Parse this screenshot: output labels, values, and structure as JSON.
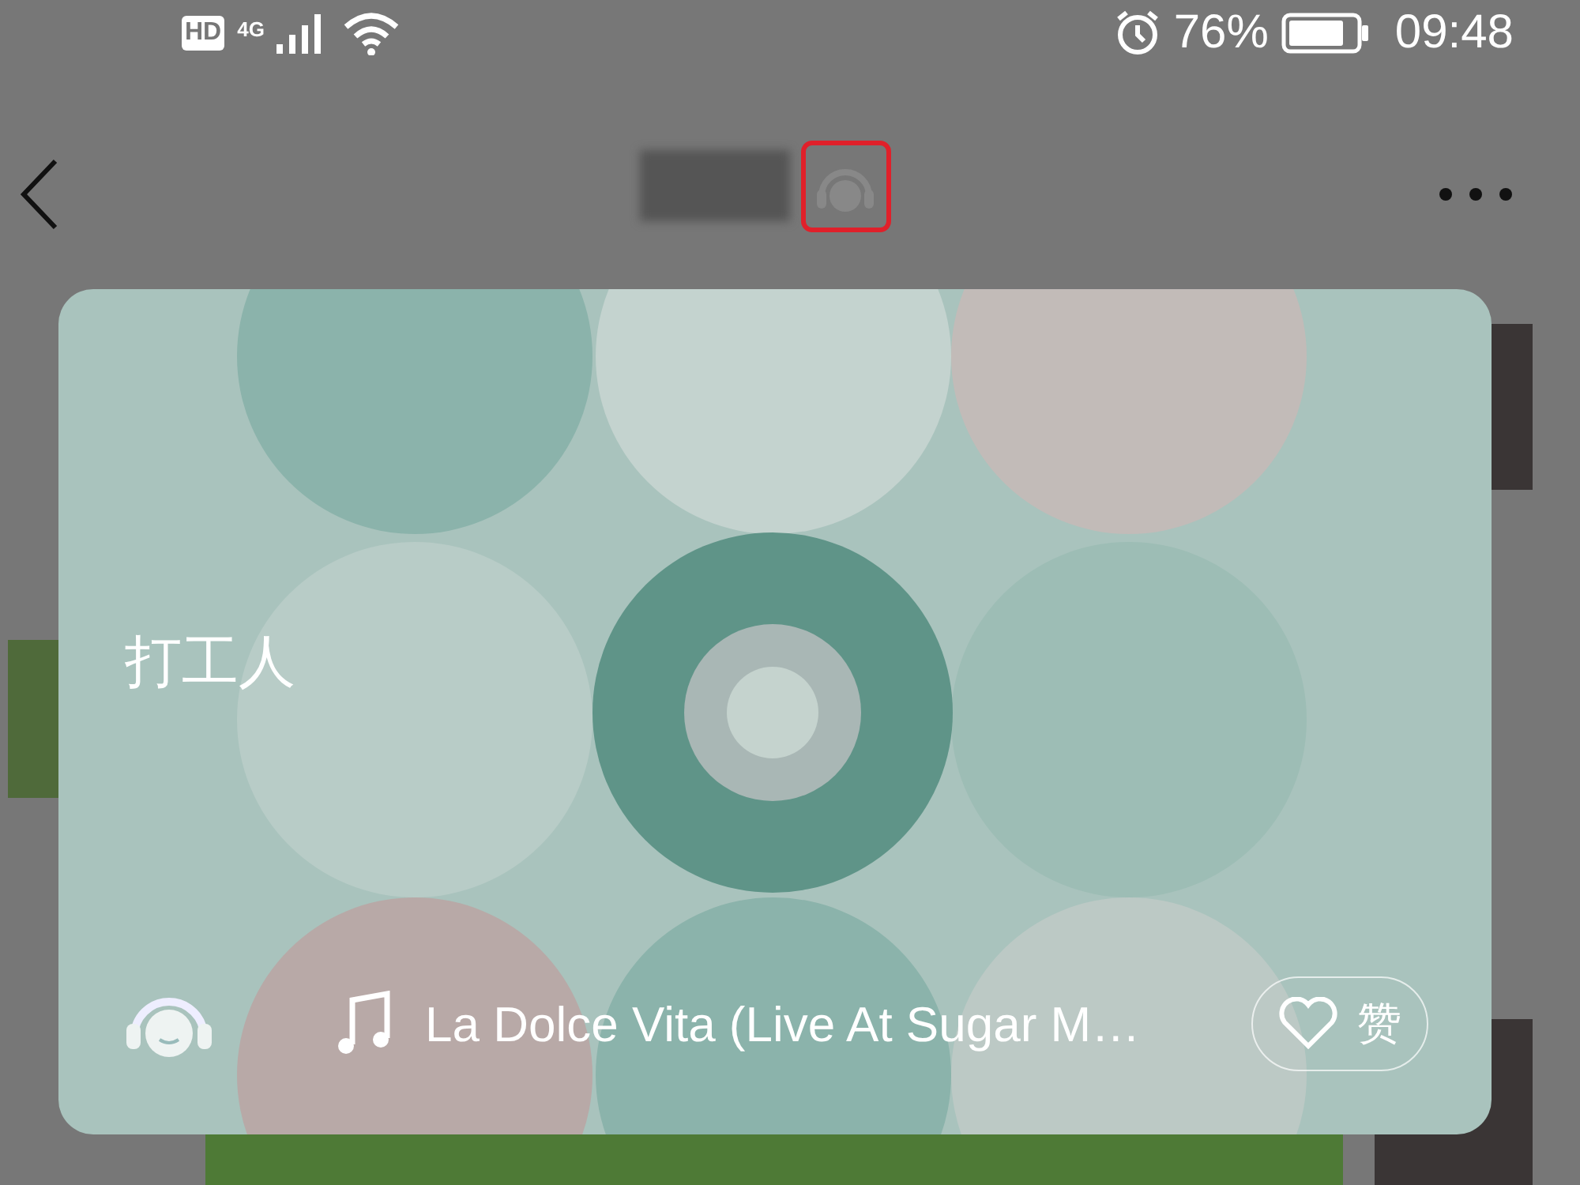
{
  "status_bar": {
    "network_badge": "HD",
    "network_type": "4G",
    "battery_percent": "76%",
    "time": "09:48"
  },
  "card": {
    "title": "打工人",
    "song": "La Dolce Vita (Live At Sugar M…",
    "like_label": "赞"
  }
}
